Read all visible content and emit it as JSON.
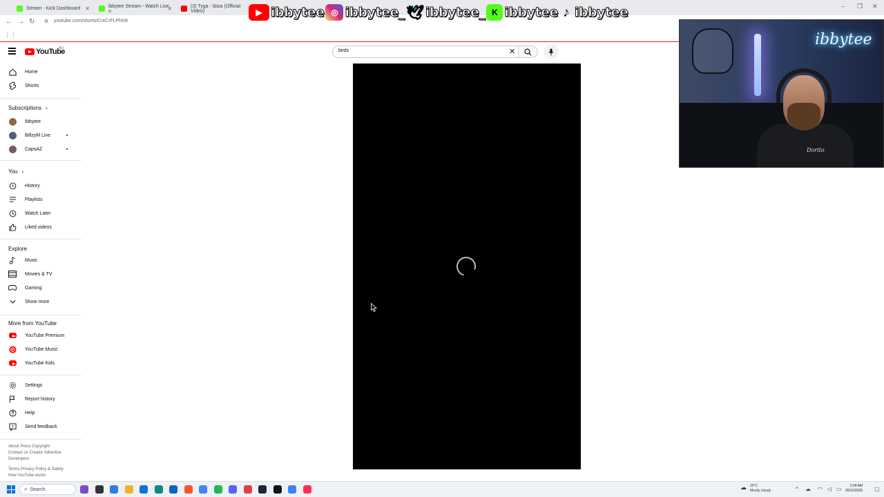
{
  "browser": {
    "tabs": [
      {
        "label": "Stream - Kick Dashboard",
        "color": "#53fc18"
      },
      {
        "label": "ibbytee Stream - Watch Live o",
        "color": "#53fc18"
      },
      {
        "label": "(3) Tyga - Ibiza (Official Video)",
        "color": "#ff0000"
      }
    ],
    "url": "youtube.com/shorts/CrxCrFLPhN8",
    "window_controls": [
      "–",
      "❐",
      "✕"
    ]
  },
  "overlay": {
    "items": [
      {
        "platform": "youtube-icon",
        "handle": "ibbytee",
        "color": "#ff0000"
      },
      {
        "platform": "instagram-icon",
        "handle": "ibbytee_",
        "color": "#d62976"
      },
      {
        "platform": "twitter-icon",
        "handle": "ibbytee_",
        "color": "#1d9bf0"
      },
      {
        "platform": "kick-icon",
        "handle": "ibbytee",
        "color": "#53fc18"
      },
      {
        "platform": "tiktok-icon",
        "handle": "ibbytee",
        "color": "#111111"
      }
    ]
  },
  "webcam": {
    "sign_text": "ibbytee",
    "shirt_text": "Dorito"
  },
  "youtube": {
    "logo_text": "YouTube",
    "country_code": "AU",
    "search": {
      "value": "birds"
    },
    "sidebar": {
      "main": [
        {
          "label": "Home",
          "icon": "home-icon"
        },
        {
          "label": "Shorts",
          "icon": "shorts-icon"
        }
      ],
      "subscriptions_heading": "Subscriptions",
      "subscriptions": [
        {
          "label": "Ibbytee",
          "avatar_color": "#8a6a4a",
          "live_dot": false
        },
        {
          "label": "BillzyM Live",
          "avatar_color": "#556070",
          "live_dot": true
        },
        {
          "label": "CapsAZ",
          "avatar_color": "#7a5a60",
          "live_dot": true
        }
      ],
      "you_heading": "You",
      "you": [
        {
          "label": "History",
          "icon": "history-icon"
        },
        {
          "label": "Playlists",
          "icon": "playlists-icon"
        },
        {
          "label": "Watch Later",
          "icon": "watch-later-icon"
        },
        {
          "label": "Liked videos",
          "icon": "liked-icon"
        }
      ],
      "explore_heading": "Explore",
      "explore": [
        {
          "label": "Music",
          "icon": "music-icon"
        },
        {
          "label": "Movies & TV",
          "icon": "movies-icon"
        },
        {
          "label": "Gaming",
          "icon": "gaming-icon"
        },
        {
          "label": "Show more",
          "icon": "chevron-down-icon"
        }
      ],
      "more_heading": "More from YouTube",
      "more": [
        {
          "label": "YouTube Premium",
          "icon": "yt-premium-icon"
        },
        {
          "label": "YouTube Music",
          "icon": "yt-music-icon"
        },
        {
          "label": "YouTube Kids",
          "icon": "yt-kids-icon"
        }
      ],
      "settings": [
        {
          "label": "Settings",
          "icon": "gear-icon"
        },
        {
          "label": "Report history",
          "icon": "flag-icon"
        },
        {
          "label": "Help",
          "icon": "help-icon"
        },
        {
          "label": "Send feedback",
          "icon": "feedback-icon"
        }
      ],
      "footer": [
        "About  Press  Copyright",
        "Contact us  Creator  Advertise",
        "Developers",
        "Terms  Privacy  Policy & Safety",
        "How YouTube works"
      ]
    }
  },
  "taskbar": {
    "search_placeholder": "Search",
    "weather_temp": "25°C",
    "weather_desc": "Mostly cloudy",
    "time": "1:04 AM",
    "date": "20/12/2025",
    "apps": [
      "#7a4cc6",
      "#333333",
      "#2f7de1",
      "#f0b429",
      "#0a74da",
      "#0f8a7e",
      "#0a66c2",
      "#fb542b",
      "#4285f4",
      "#1db954",
      "#5865f2",
      "#e33e3e",
      "#1b2838",
      "#111111",
      "#3b82f6",
      "#ff2d55"
    ]
  }
}
